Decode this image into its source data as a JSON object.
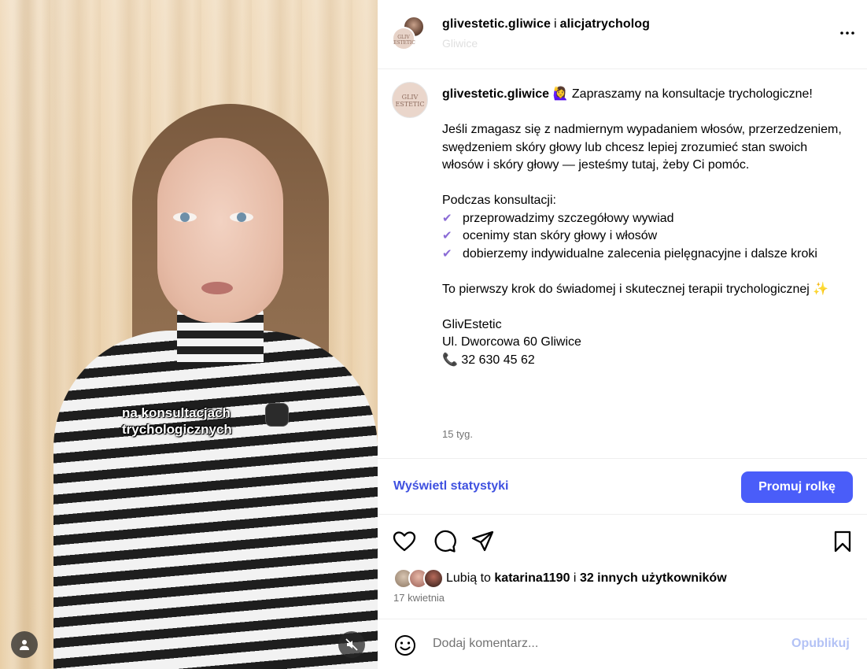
{
  "media": {
    "caption_line1": "na konsultacjach",
    "caption_line2": "trychologicznych"
  },
  "header": {
    "user1": "glivestetic.gliwice",
    "separator": "i",
    "user2": "alicjatrycholog",
    "location": "Gliwice",
    "avatar_text": "GLIV ESTETIC"
  },
  "post": {
    "username": "glivestetic.gliwice",
    "lead_emoji": "🙋‍♀️",
    "lead_text": "Zapraszamy na konsultacje trychologiczne!",
    "para1": "Jeśli zmagasz się z nadmiernym wypadaniem włosów, przerzedzeniem, swędzeniem skóry głowy lub chcesz lepiej zrozumieć stan swoich włosów i skóry głowy — jesteśmy tutaj, żeby Ci pomóc.",
    "consult_heading": "Podczas konsultacji:",
    "check_glyph": "✔",
    "bullets": [
      "przeprowadzimy szczegółowy wywiad",
      "ocenimy stan skóry głowy i włosów",
      "dobierzemy indywidualne zalecenia pielęgnacyjne i dalsze kroki"
    ],
    "closing": "To pierwszy krok do świadomej i skutecznej terapii trychologicznej",
    "closing_emoji": "✨",
    "company": "GlivEstetic",
    "address": "Ul. Dworcowa 60 Gliwice",
    "phone_icon": "📞",
    "phone": "32 630 45 62",
    "time_ago": "15 tyg."
  },
  "statbar": {
    "stats_label": "Wyświetl statystyki",
    "promote_label": "Promuj rolkę"
  },
  "actions": {
    "icons": [
      "heart-icon",
      "comment-icon",
      "share-icon",
      "bookmark-icon"
    ],
    "likes_prefix": "Lubią to",
    "likes_user": "katarina1190",
    "likes_mid": "i",
    "likes_others": "32 innych użytkowników",
    "date": "17 kwietnia"
  },
  "comment": {
    "placeholder": "Dodaj komentarz...",
    "publish_label": "Opublikuj"
  },
  "colors": {
    "accent": "#4a5df9",
    "stats_link": "#3f51e0",
    "muted_text": "#737373",
    "publish_disabled": "#b3c2f5",
    "check": "#8a6bd6"
  }
}
